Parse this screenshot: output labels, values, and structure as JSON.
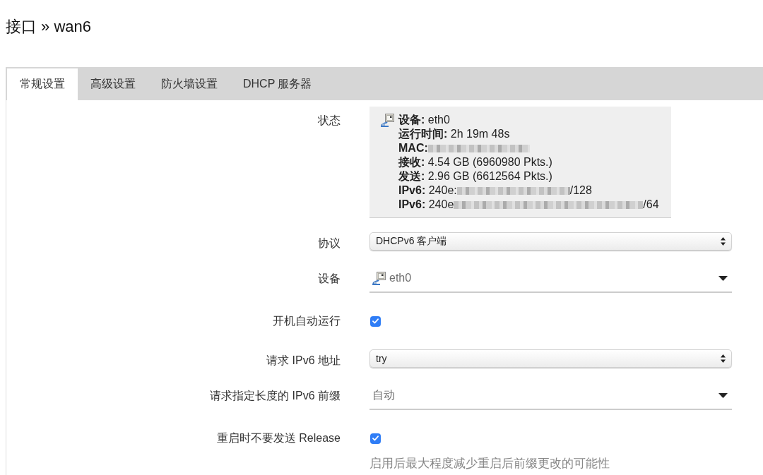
{
  "page": {
    "title": "接口 » wan6"
  },
  "tabs": [
    {
      "label": "常规设置",
      "selected": true
    },
    {
      "label": "高级设置",
      "selected": false
    },
    {
      "label": "防火墙设置",
      "selected": false
    },
    {
      "label": "DHCP 服务器",
      "selected": false
    }
  ],
  "form": [
    {
      "kind": "status",
      "label": "状态",
      "lines": [
        {
          "icon": true,
          "label": "设备:",
          "value": "eth0"
        },
        {
          "label": "运行时间:",
          "value": "2h 19m 48s"
        },
        {
          "label": "MAC:",
          "blurred": true
        },
        {
          "label": "接收:",
          "value": "4.54 GB (6960980 Pkts.)"
        },
        {
          "label": "发送:",
          "value": "2.96 GB (6612564 Pkts.)"
        },
        {
          "label": "IPv6:",
          "value": "240e:",
          "blurred": true,
          "suffix": "/128"
        },
        {
          "label": "IPv6:",
          "value": "240e",
          "blurred": true,
          "suffix": "/64"
        }
      ]
    },
    {
      "kind": "select",
      "label": "协议",
      "value": "DHCPv6 客户端"
    },
    {
      "kind": "dropdown",
      "label": "设备",
      "value": "eth0",
      "icon": true
    },
    {
      "kind": "checkbox",
      "label": "开机自动运行",
      "checked": true
    },
    {
      "kind": "select",
      "label": "请求 IPv6 地址",
      "value": "try"
    },
    {
      "kind": "dropdown",
      "label": "请求指定长度的 IPv6 前缀",
      "value": "自动"
    },
    {
      "kind": "checkbox",
      "label": "重启时不要发送 Release",
      "checked": true,
      "description": "启用后最大程度减少重启后前缀更改的可能性"
    }
  ]
}
